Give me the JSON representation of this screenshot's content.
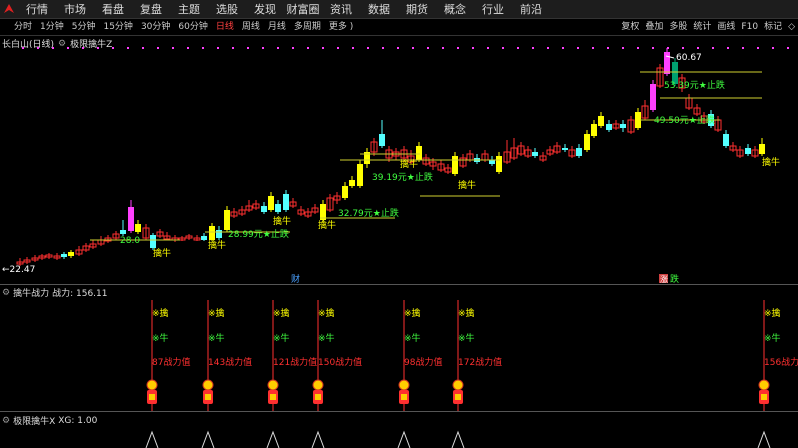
{
  "menubar": {
    "items": [
      "行情",
      "市场",
      "看盘",
      "复盘",
      "主题",
      "选股",
      "发现",
      "财富圈",
      "资讯",
      "数据",
      "期货",
      "概念",
      "行业",
      "前沿"
    ]
  },
  "periodbar": {
    "periods": [
      "分时",
      "1分钟",
      "5分钟",
      "15分钟",
      "30分钟",
      "60分钟",
      "日线",
      "周线",
      "月线",
      "多周期",
      "更多 )"
    ],
    "active_period": "日线",
    "tools": [
      "复权",
      "叠加",
      "多股",
      "统计",
      "画线",
      "F10",
      "标记"
    ],
    "tools_extra": "◇"
  },
  "chart": {
    "stock_name": "长白山(日线)",
    "indicator_name": "极限擒牛Z",
    "high_label": "60.67",
    "low_label": "←22.47",
    "stop_labels": [
      {
        "text": "28.0",
        "color": "#40ff40"
      },
      {
        "text": "28.99元★止跌",
        "color": "#40ff40"
      },
      {
        "text": "32.79元★止跌",
        "color": "#40ff40"
      },
      {
        "text": "39.19元★止跌",
        "color": "#40ff40"
      },
      {
        "text": "49.50元★止跌",
        "color": "#40ff40"
      },
      {
        "text": "53.39元★止跌",
        "color": "#40ff40"
      }
    ],
    "buy_label": "擒牛",
    "cai_label": "财",
    "zhang_label": "涨",
    "die_label": "跌"
  },
  "panel2": {
    "title": "擒牛战力",
    "value_label": "战力: 156.11",
    "qin_text": "※擒",
    "niu_text": "※牛",
    "signals": [
      {
        "value": "87战力值"
      },
      {
        "value": "143战力值"
      },
      {
        "value": "121战力值"
      },
      {
        "value": "150战力值"
      },
      {
        "value": "98战力值"
      },
      {
        "value": "172战力值"
      },
      {
        "value": "156战力值"
      }
    ]
  },
  "panel3": {
    "title": "极限擒牛X",
    "value_label": "XG: 1.00"
  },
  "colors": {
    "up_yellow": "#ffff00",
    "down_cyan": "#54ffff",
    "magenta": "#ff40ff",
    "red": "#ff3030",
    "green": "#40ff40"
  }
}
